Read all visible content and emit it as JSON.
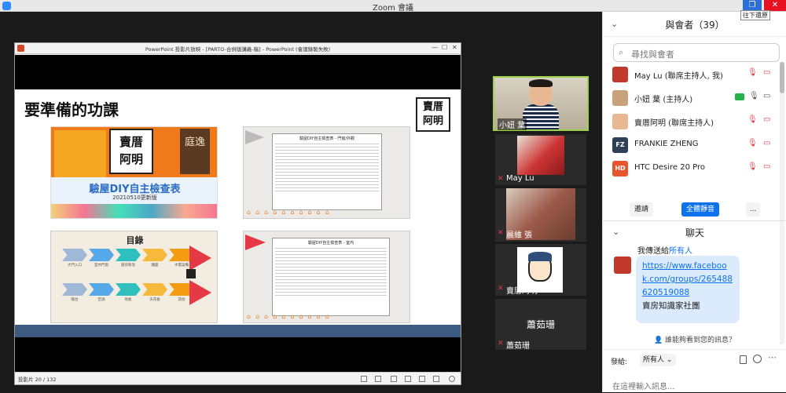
{
  "window": {
    "title": "Zoom 會議",
    "restore_tooltip": "往下還原"
  },
  "ppt": {
    "window_title": "PowerPoint 投影片放映 - [PARTO-合併版講義-稿] - PowerPoint (會議錄製失敗)",
    "status": "投影片 20 / 132",
    "slide": {
      "title": "要準備的功課",
      "logo_text": "賣厝阿明",
      "thumb1": {
        "brand": "賣厝阿明",
        "side": "庭逸",
        "headline": "驗屋DIY自主檢查表",
        "date": "20210510更新版"
      },
      "thumb2": {
        "sheet_title": "驗屋DIY自主檢查表 - 門窗/外觀"
      },
      "thumb3": {
        "toc_title": "目錄",
        "row1": [
          "大門入口",
          "室內門窗",
          "廚房衛浴",
          "牆面",
          "水電設備"
        ],
        "row2": [
          "陽台",
          "空調",
          "地板",
          "天花板",
          "其他"
        ]
      },
      "thumb4": {
        "sheet_title": "驗屋DIY自主檢查表 - 室內"
      }
    }
  },
  "tiles": [
    {
      "name": "小妞 葉",
      "speaking": true
    },
    {
      "name": "May Lu",
      "muted": true
    },
    {
      "name": "晨維 張",
      "muted": true
    },
    {
      "name": "賣厝阿明",
      "muted": true
    },
    {
      "name": "蕭茹珊",
      "label": "蕭茹珊",
      "muted": true
    }
  ],
  "participants_panel": {
    "title": "與會者（39）",
    "search_placeholder": "尋找與會者",
    "people": [
      {
        "name": "May Lu (聯席主持人, 我)",
        "avatar_color": "#c0392b",
        "initials": ""
      },
      {
        "name": "小妞 葉 (主持人)",
        "avatar_color": "#c8a27a",
        "initials": ""
      },
      {
        "name": "賣厝阿明 (聯席主持人)",
        "avatar_color": "#e7b892",
        "initials": ""
      },
      {
        "name": "FRANKIE ZHENG",
        "avatar_color": "#2e4057",
        "initials": "FZ"
      },
      {
        "name": "HTC Desire 20 Pro",
        "avatar_color": "#e8542c",
        "initials": "HD"
      }
    ],
    "invite": "邀請",
    "mute_all": "全體靜音",
    "more": "..."
  },
  "chat": {
    "title": "聊天",
    "from_prefix": "我傳送給",
    "to": "所有人",
    "message_link": "https://www.facebook.com/groups/265488620519088",
    "message_text": "賣房知識家社團",
    "who_can_see": "誰能夠看到您的訊息？",
    "send_to_label": "發給:",
    "recipient": "所有人 ⌄",
    "input_placeholder": "在這裡輸入訊息..."
  }
}
